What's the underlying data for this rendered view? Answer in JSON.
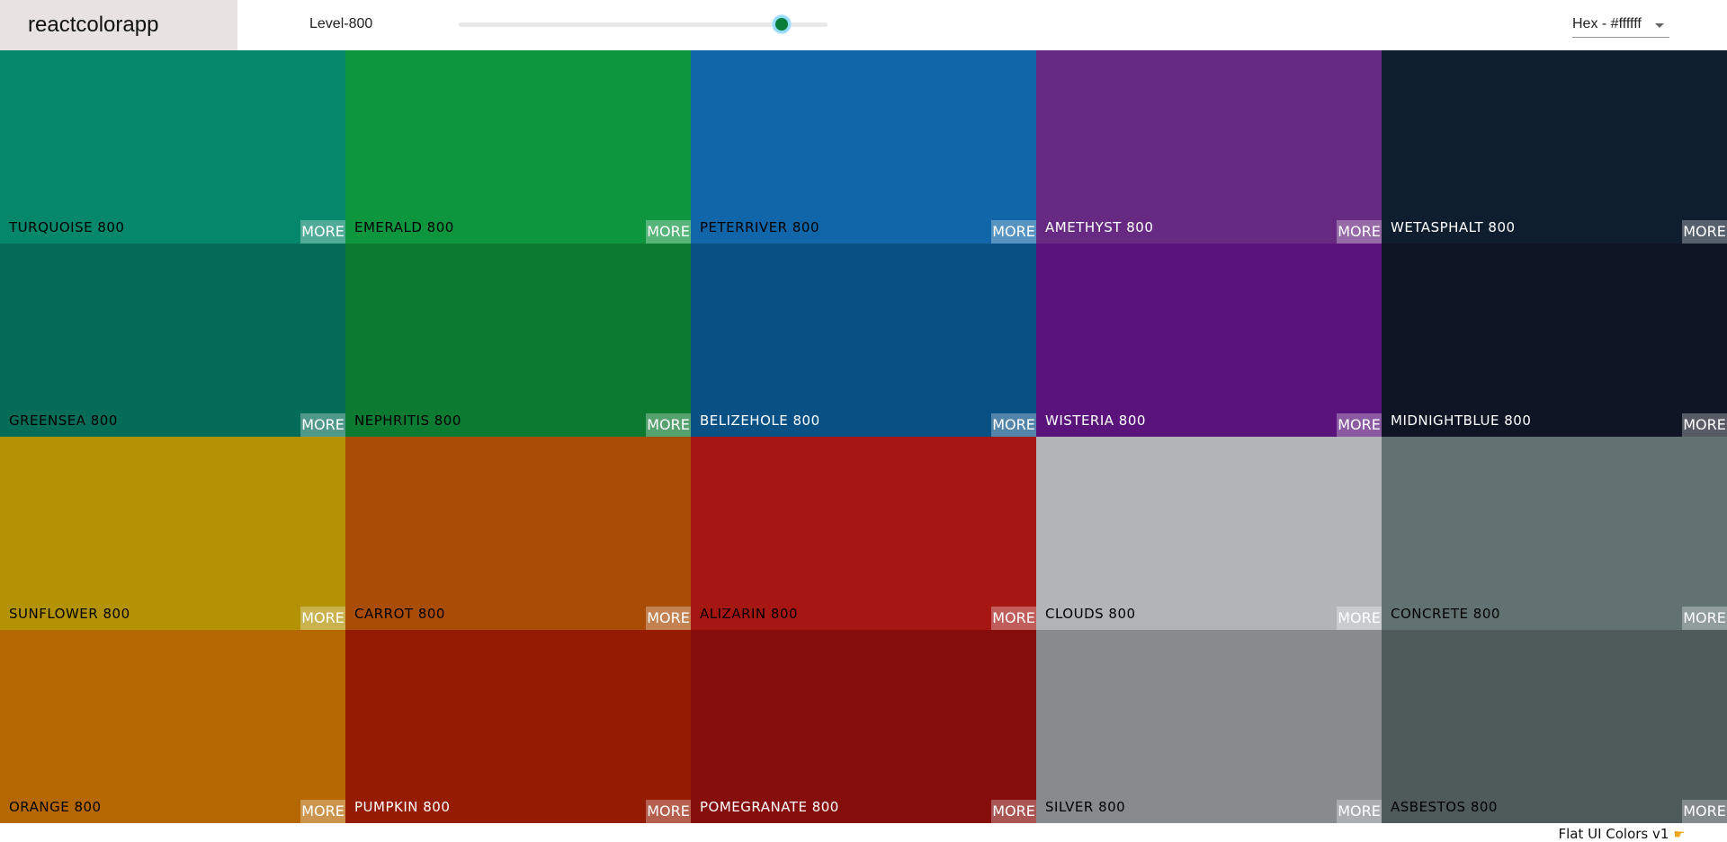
{
  "navbar": {
    "logo": "reactcolorapp",
    "level_label": "Level-800",
    "slider_level": 800,
    "slider_min": 100,
    "slider_max": 900,
    "format_select": "Hex - #ffffff"
  },
  "palette": {
    "more_label": "MORE",
    "colors": [
      {
        "name": "TURQUOISE 800",
        "color": "#05876b",
        "text": "#000000"
      },
      {
        "name": "EMERALD 800",
        "color": "#0e963f",
        "text": "#000000"
      },
      {
        "name": "PETERRIVER 800",
        "color": "#1066a8",
        "text": "#000000"
      },
      {
        "name": "AMETHYST 800",
        "color": "#672a82",
        "text": "#ffffff"
      },
      {
        "name": "WETASPHALT 800",
        "color": "#0e1e2e",
        "text": "#ffffff"
      },
      {
        "name": "GREENSEA 800",
        "color": "#056c57",
        "text": "#000000"
      },
      {
        "name": "NEPHRITIS 800",
        "color": "#0c7a31",
        "text": "#000000"
      },
      {
        "name": "BELIZEHOLE 800",
        "color": "#095084",
        "text": "#ffffff"
      },
      {
        "name": "WISTERIA 800",
        "color": "#5a137a",
        "text": "#ffffff"
      },
      {
        "name": "MIDNIGHTBLUE 800",
        "color": "#0f1524",
        "text": "#ffffff"
      },
      {
        "name": "SUNFLOWER 800",
        "color": "#b39203",
        "text": "#000000"
      },
      {
        "name": "CARROT 800",
        "color": "#a84c06",
        "text": "#000000"
      },
      {
        "name": "ALIZARIN 800",
        "color": "#a61713",
        "text": "#000000"
      },
      {
        "name": "CLOUDS 800",
        "color": "#b2b5b6",
        "text": "#000000"
      },
      {
        "name": "CONCRETE 800",
        "color": "#627272",
        "text": "#000000"
      },
      {
        "name": "ORANGE 800",
        "color": "#b56802",
        "text": "#000000"
      },
      {
        "name": "PUMPKIN 800",
        "color": "#951c03",
        "text": "#ffffff"
      },
      {
        "name": "POMEGRANATE 800",
        "color": "#850e0c",
        "text": "#ffffff"
      },
      {
        "name": "SILVER 800",
        "color": "#878b8e",
        "text": "#000000"
      },
      {
        "name": "ASBESTOS 800",
        "color": "#4f5a5b",
        "text": "#000000"
      }
    ]
  },
  "footer": {
    "text": "Flat UI Colors v1",
    "icon": "pointing-hand-icon"
  }
}
